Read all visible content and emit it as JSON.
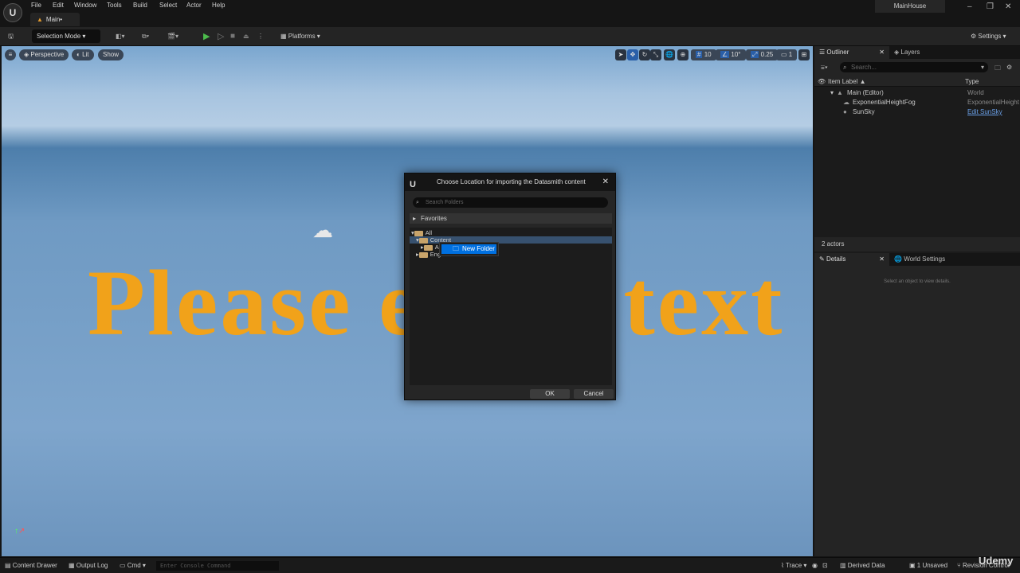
{
  "app": {
    "logo": "U",
    "project": "MainHouse",
    "tab": "Main•",
    "menu": [
      "File",
      "Edit",
      "Window",
      "Tools",
      "Build",
      "Select",
      "Actor",
      "Help"
    ]
  },
  "toolbar": {
    "selection_mode": "Selection Mode",
    "platforms": "Platforms",
    "settings": "Settings"
  },
  "viewport": {
    "perspective": "Perspective",
    "lit": "Lit",
    "show": "Show",
    "grid": "10",
    "angle": "10°",
    "scale": "0.25",
    "camera": "1",
    "watermark": "Please enter text"
  },
  "dialog": {
    "title": "Choose Location for importing the Datasmith content",
    "search_placeholder": "Search Folders",
    "favorites": "Favorites",
    "tree": {
      "all": "All",
      "content": "Content",
      "ar": "Ar",
      "eng": "Eng"
    },
    "context_new_folder": "New Folder",
    "ok": "OK",
    "cancel": "Cancel"
  },
  "outliner": {
    "tab": "Outliner",
    "layers": "Layers",
    "search_placeholder": "Search...",
    "col_label": "Item Label ▲",
    "col_type": "Type",
    "rows": [
      {
        "label": "Main (Editor)",
        "type": "World"
      },
      {
        "label": "ExponentialHeightFog",
        "type": "ExponentialHeight"
      },
      {
        "label": "SunSky",
        "type": "Edit SunSky"
      }
    ],
    "count": "2 actors"
  },
  "details": {
    "tab": "Details",
    "world_settings": "World Settings",
    "empty": "Select an object to view details."
  },
  "status": {
    "content_drawer": "Content Drawer",
    "output_log": "Output Log",
    "cmd": "Cmd",
    "console_placeholder": "Enter Console Command",
    "trace": "Trace",
    "derived_data": "Derived Data",
    "unsaved": "1 Unsaved",
    "revision": "Revision Control",
    "brand": "Udemy"
  }
}
